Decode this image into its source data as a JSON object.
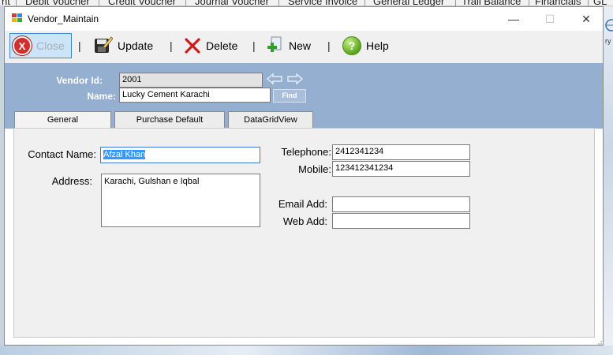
{
  "background_tabs": [
    "nt",
    "Debit Voucher",
    "Credit Voucher",
    "Journal Voucher",
    "Service Invoice",
    "General Ledger",
    "Trail Balance",
    "Financials",
    "GL"
  ],
  "background_right_text": "ry",
  "window": {
    "title": "Vendor_Maintain",
    "minimize_glyph": "—",
    "maximize_glyph": "☐",
    "close_glyph": "✕"
  },
  "toolbar": {
    "close_label": "Close",
    "update_label": "Update",
    "delete_label": "Delete",
    "new_label": "New",
    "help_label": "Help",
    "separator": "|",
    "close_icon_glyph": "X",
    "help_icon_glyph": "?"
  },
  "header": {
    "vendor_id_label": "Vendor Id:",
    "vendor_id_value": "2001",
    "name_label": "Name:",
    "name_value": "Lucky Cement Karachi",
    "find_label": "Find"
  },
  "tabs": [
    "General",
    "Purchase Default",
    "DataGridView"
  ],
  "general": {
    "contact_name_label": "Contact Name:",
    "contact_name_value": "Afzal Khan",
    "address_label": "Address:",
    "address_value": "Karachi, Gulshan e Iqbal",
    "telephone_label": "Telephone:",
    "telephone_value": "2412341234",
    "mobile_label": "Mobile:",
    "mobile_value": "123412341234",
    "email_label": "Email Add:",
    "email_value": "",
    "web_label": "Web Add:",
    "web_value": ""
  },
  "colors": {
    "header_bg": "#95afd1",
    "panel_bg": "#f0f0f0",
    "selection": "#3399ff",
    "close_button_hover": "#cce4f7"
  }
}
